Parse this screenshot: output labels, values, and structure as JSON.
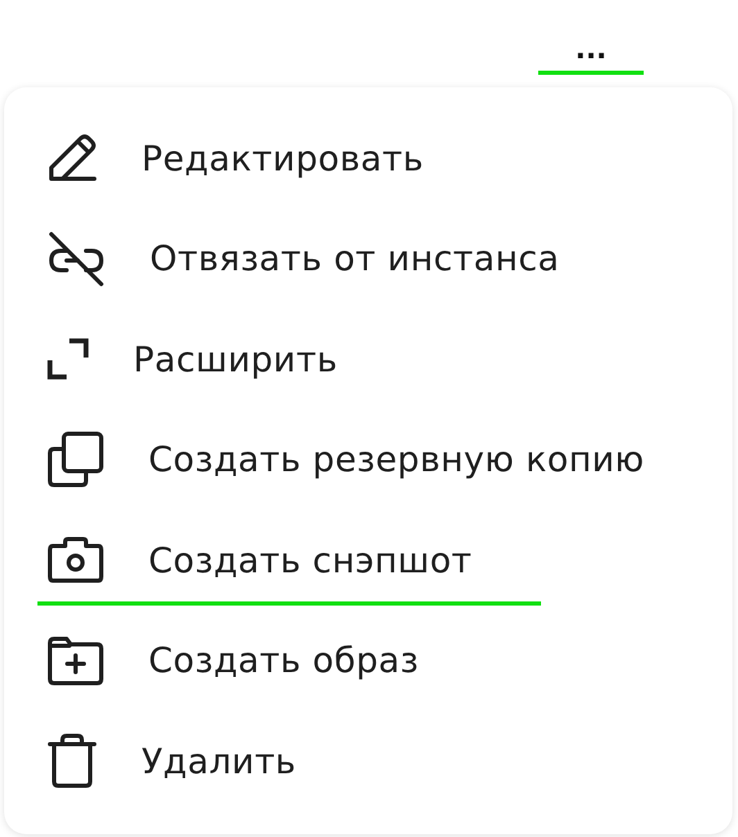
{
  "more_button": {
    "label": "...",
    "underlined": true
  },
  "menu": {
    "items": [
      {
        "label": "Редактировать",
        "underlined": false
      },
      {
        "label": "Отвязать от инстанса",
        "underlined": false
      },
      {
        "label": "Расширить",
        "underlined": false
      },
      {
        "label": "Создать резервную копию",
        "underlined": false
      },
      {
        "label": "Создать снэпшот",
        "underlined": true
      },
      {
        "label": "Создать образ",
        "underlined": false
      },
      {
        "label": "Удалить",
        "underlined": false
      }
    ]
  }
}
